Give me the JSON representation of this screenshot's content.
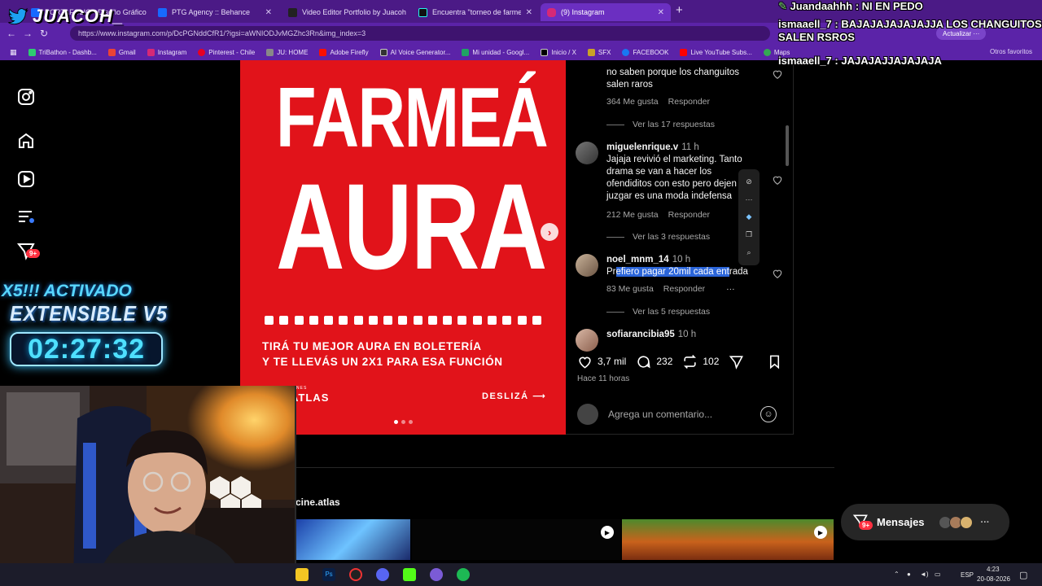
{
  "browser": {
    "tabs": [
      {
        "title": "PORTAFOLIO - Diseño Gráfico :: Be",
        "color": "#1769ff"
      },
      {
        "title": "PTG Agency :: Behance",
        "color": "#1769ff"
      },
      {
        "title": "Video Editor Portfolio by Juacoh",
        "color": "#111111"
      },
      {
        "title": "Encuentra \"torneo de farmear aura\"",
        "color": "#111111"
      },
      {
        "title": "(9) Instagram",
        "color": "#d62976"
      }
    ],
    "url": "https://www.instagram.com/p/DcPGNddCfR1/?igsi=aWNIODJvMGZhc3Rn&img_index=3",
    "update_label": "Actualizar",
    "bookmarks": [
      {
        "label": "TriBathon - Dashb...",
        "color": "#2ecc71"
      },
      {
        "label": "Gmail",
        "color": "#ea4335"
      },
      {
        "label": "Instagram",
        "color": "#d62976"
      },
      {
        "label": "Pinterest - Chile",
        "color": "#e60023"
      },
      {
        "label": "JU: HOME",
        "color": "#888888"
      },
      {
        "label": "Adobe Firefly",
        "color": "#fa0f00"
      },
      {
        "label": "AI Voice Generator...",
        "color": "#333333"
      },
      {
        "label": "Mi unidad - Googl...",
        "color": "#1fa463"
      },
      {
        "label": "Inicio / X",
        "color": "#000000"
      },
      {
        "label": "SFX",
        "color": "#c9a227"
      },
      {
        "label": "FACEBOOK",
        "color": "#1877f2"
      },
      {
        "label": "Live YouTube Subs...",
        "color": "#ff0000"
      },
      {
        "label": "Maps",
        "color": "#34a853"
      }
    ],
    "other_bookmarks": "Otros favoritos"
  },
  "sidebar": {
    "notifications_badge": "9+"
  },
  "post": {
    "headline_1": "FARMEÁ",
    "headline_2": "AURA",
    "promo_1": "TIRÁ TU MEJOR AURA EN BOLETERÍA",
    "promo_2": "Y TE LLEVÁS UN 2X1 PARA ESA FUNCIÓN",
    "brand_small": "CINES",
    "brand": "ATLAS",
    "swipe": "DESLIZÁ",
    "brand_color": "#e1131a"
  },
  "comments": [
    {
      "text": "no saben porque los changuitos salen raros",
      "likes": "364 Me gusta",
      "reply": "Responder",
      "view_replies": "Ver las 17 respuestas"
    },
    {
      "user": "miguelenrique.v",
      "time": "11 h",
      "text": "Jajaja revivió el marketing. Tanto drama se van a hacer los ofendiditos con esto pero dejen de juzgar es una moda indefensa",
      "likes": "212 Me gusta",
      "reply": "Responder",
      "view_replies": "Ver las 3 respuestas"
    },
    {
      "user": "noel_mnm_14",
      "time": "10 h",
      "text_pre": "Pr",
      "text_hl": "efiero pagar 20mil cada ent",
      "text_post": "rada",
      "likes": "83 Me gusta",
      "reply": "Responder",
      "view_replies": "Ver las 5 respuestas"
    },
    {
      "user": "sofiarancibia95",
      "time": "10 h"
    }
  ],
  "actions": {
    "likes": "3,7 mil",
    "comments": "232",
    "reposts": "102",
    "time_ago": "Hace 11 horas",
    "comment_placeholder": "Agrega un comentario..."
  },
  "more_from": "cine.atlas",
  "messages": {
    "label": "Mensajes",
    "badge": "9+"
  },
  "stream": {
    "channel": "JUACOH_",
    "chat": [
      {
        "user": "Juandaahhh",
        "text": "NI EN PEDO"
      },
      {
        "user": "ismaaell_7",
        "text": "BAJAJAJAJAJAJJA LOS CHANGUITOS SALEN RSROS"
      },
      {
        "user": "ismaaell_7",
        "text": "JAJAJAJJAJAJAJA"
      }
    ],
    "timer_title": "X5!!! ACTIVADO",
    "timer_subtitle": "EXTENSIBLE V5",
    "timer": "02:27:32"
  },
  "taskbar": {
    "lang": "ESP",
    "time": "4:23",
    "date": "20-08-2026"
  }
}
